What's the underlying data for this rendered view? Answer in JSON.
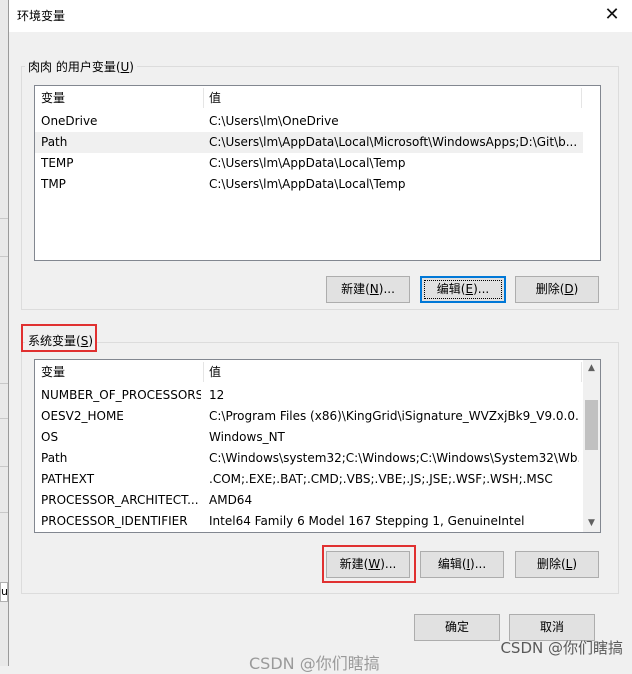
{
  "window": {
    "title": "环境变量"
  },
  "user_group": {
    "label_prefix": "肉肉 的用户变量(",
    "label_key": "U",
    "label_suffix": ")",
    "columns": [
      "变量",
      "值"
    ],
    "rows": [
      {
        "name": "OneDrive",
        "value": "C:\\Users\\lm\\OneDrive"
      },
      {
        "name": "Path",
        "value": "C:\\Users\\lm\\AppData\\Local\\Microsoft\\WindowsApps;D:\\Git\\b..."
      },
      {
        "name": "TEMP",
        "value": "C:\\Users\\lm\\AppData\\Local\\Temp"
      },
      {
        "name": "TMP",
        "value": "C:\\Users\\lm\\AppData\\Local\\Temp"
      }
    ],
    "buttons": {
      "new": {
        "prefix": "新建(",
        "key": "N",
        "suffix": ")..."
      },
      "edit": {
        "prefix": "编辑(",
        "key": "E",
        "suffix": ")..."
      },
      "delete": {
        "prefix": "删除(",
        "key": "D",
        "suffix": ")"
      }
    }
  },
  "system_group": {
    "label_prefix": "系统变量(",
    "label_key": "S",
    "label_suffix": ")",
    "columns": [
      "变量",
      "值"
    ],
    "rows": [
      {
        "name": "NUMBER_OF_PROCESSORS",
        "value": "12"
      },
      {
        "name": "OESV2_HOME",
        "value": "C:\\Program Files (x86)\\KingGrid\\iSignature_WVZxjBk9_V9.0.0...."
      },
      {
        "name": "OS",
        "value": "Windows_NT"
      },
      {
        "name": "Path",
        "value": "C:\\Windows\\system32;C:\\Windows;C:\\Windows\\System32\\Wb..."
      },
      {
        "name": "PATHEXT",
        "value": ".COM;.EXE;.BAT;.CMD;.VBS;.VBE;.JS;.JSE;.WSF;.WSH;.MSC"
      },
      {
        "name": "PROCESSOR_ARCHITECT...",
        "value": "AMD64"
      },
      {
        "name": "PROCESSOR_IDENTIFIER",
        "value": "Intel64 Family 6 Model 167 Stepping 1, GenuineIntel"
      }
    ],
    "buttons": {
      "new": {
        "prefix": "新建(",
        "key": "W",
        "suffix": ")..."
      },
      "edit": {
        "prefix": "编辑(",
        "key": "I",
        "suffix": ")..."
      },
      "delete": {
        "prefix": "删除(",
        "key": "L",
        "suffix": ")"
      }
    }
  },
  "footer": {
    "ok": "确定",
    "cancel": "取消"
  },
  "watermark": "CSDN @你们瞎搞",
  "watermark_behind": "CSDN @你们瞎搞",
  "left_cut_text": "u",
  "colors": {
    "highlight": "#e03030",
    "accent": "#0078d7"
  }
}
